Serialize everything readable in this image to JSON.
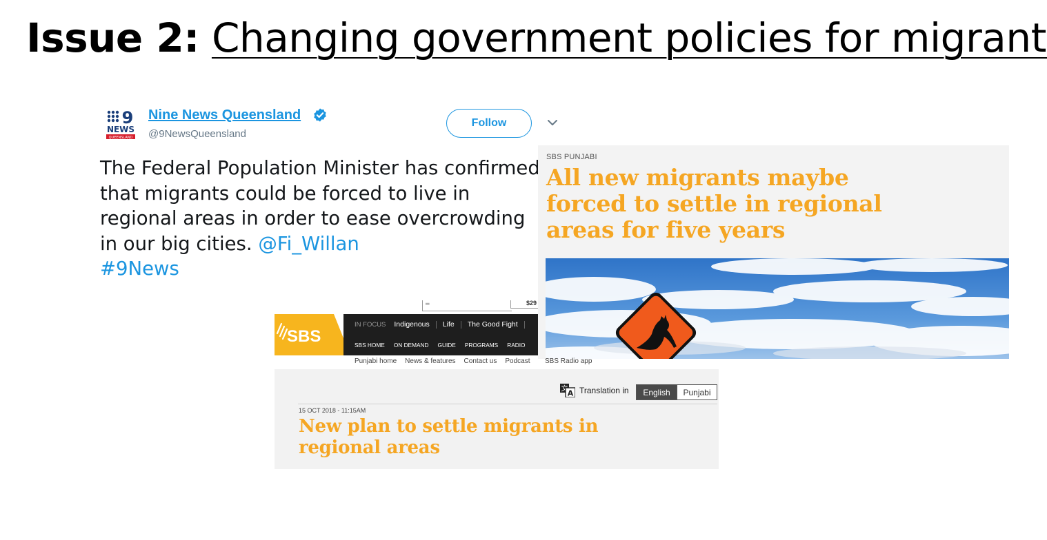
{
  "slide": {
    "title_prefix": "Issue 2:",
    "title_main": "Changing government policies for migrants"
  },
  "tweet": {
    "logo_text_top": "9",
    "logo_text_mid": "NEWS",
    "logo_text_bottom": "QUEENSLAND",
    "display_name": "Nine News Queensland",
    "handle": "@9NewsQueensland",
    "follow_label": "Follow",
    "body_text": "The Federal Population Minister has confirmed that migrants could be forced to live in regional areas in order to ease overcrowding in our big cities. ",
    "mention": "@Fi_Willan",
    "hashtag": "#9News",
    "colors": {
      "link": "#1b95e0",
      "logo_red": "#d71e2b",
      "logo_blue": "#1a3e7a"
    },
    "icons": {
      "verified": "verified-badge-icon",
      "caret": "chevron-down-icon"
    }
  },
  "sbs_article_right": {
    "kicker": "SBS PUNJABI",
    "headline": "All new migrants maybe forced to settle in regional areas for five years",
    "color_headline": "#f5a623",
    "photo_icon": "kangaroo-road-sign-icon"
  },
  "sbs_site": {
    "top_mark": "=",
    "price": "$29",
    "logo_text": "SBS",
    "nav_primary": {
      "focus_label": "IN FOCUS",
      "items": [
        "Indigenous",
        "Life",
        "The Good Fight"
      ]
    },
    "nav_secondary": [
      "SBS HOME",
      "ON DEMAND",
      "GUIDE",
      "PROGRAMS",
      "RADIO"
    ],
    "sub_nav": [
      "Punjabi home",
      "News & features",
      "Contact us",
      "Podcast",
      "SBS Radio app"
    ],
    "colors": {
      "brand_yellow": "#f7b51e",
      "nav_bg": "#1e1e1e"
    }
  },
  "sbs_article_bottom": {
    "translation_label": "Translation in",
    "lang_selected": "English",
    "lang_other": "Punjabi",
    "date": "15 OCT 2018 - 11:15AM",
    "headline": "New plan to settle migrants in regional areas",
    "translate_icon": "translate-icon"
  }
}
